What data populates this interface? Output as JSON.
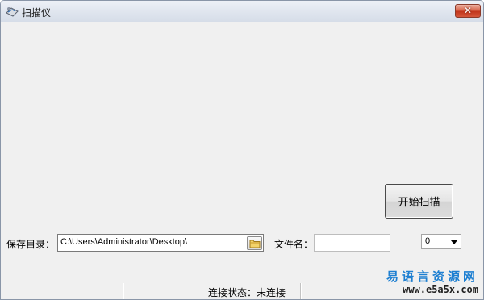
{
  "window": {
    "title": "扫描仪",
    "close_glyph": "✕",
    "icon": "scanner-icon"
  },
  "main": {
    "start_button_label": "开始扫描",
    "save_dir_label": "保存目录：",
    "save_dir_value": "C:\\Users\\Administrator\\Desktop\\",
    "browse_icon": "folder-icon",
    "file_name_label": "文件名：",
    "file_name_value": "",
    "combo_value": "0"
  },
  "statusbar": {
    "connection_status": "连接状态：未连接"
  },
  "watermark": {
    "site_name": "易语言资源网",
    "site_url": "www.e5a5x.com"
  },
  "colors": {
    "window_bg": "#f0f0f0",
    "close_red": "#c2361c",
    "watermark_blue": "#1d7fd1"
  }
}
